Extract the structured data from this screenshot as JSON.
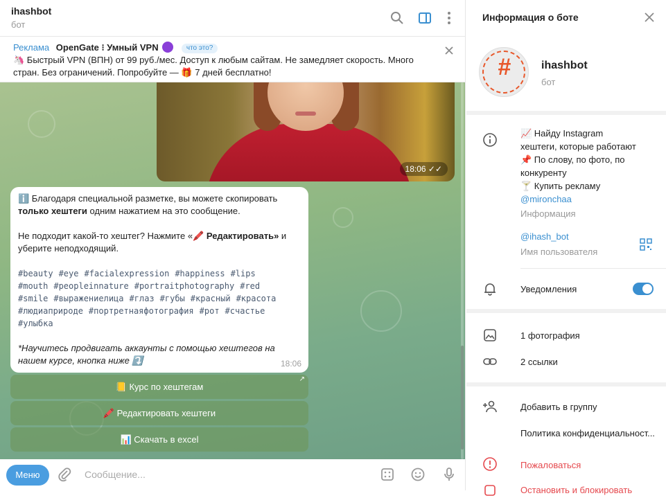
{
  "chat": {
    "title": "ihashbot",
    "subtitle": "бот"
  },
  "ad": {
    "label": "Реклама",
    "title": "OpenGate ⁝ Умный VPN",
    "what": "что это?",
    "text_line1": "🦄 Быстрый VPN (ВПН) от 99 руб./мес. Доступ к любым сайтам. Не замедляет скорость. Много",
    "text_line2": "стран. Без ограничений. Попробуйте — 🎁 7 дней бесплатно!"
  },
  "photo": {
    "time": "18:06"
  },
  "message": {
    "p1_pre": "ℹ️ Благодаря специальной разметке, вы можете скопировать",
    "p1_bold": "только хештеги",
    "p1_post": " одним нажатием на это сообщение.",
    "p2_pre": "Не подходит какой-то хештег? Нажмите «🖍️ ",
    "p2_bold": "Редактировать»",
    "p2_post": " и",
    "p2_line2": "уберите неподходящий.",
    "tags": [
      "#beauty",
      "#eye",
      "#facialexpression",
      "#happiness",
      "#lips",
      "#mouth",
      "#peopleinnature",
      "#portraitphotography",
      "#red",
      "#smile",
      "#выражениелица",
      "#глаз",
      "#губы",
      "#красный",
      "#красота",
      "#людиаприроде",
      "#портретнаяфотография",
      "#рот",
      "#счастье",
      "#улыбка"
    ],
    "footer_line1": "*Научитесь продвигать аккаунты с помощью хештегов на",
    "footer_line2": "нашем курсе, кнопка ниже ⤵️",
    "time": "18:06"
  },
  "keyboard": {
    "btn1": "📒 Курс по хештегам",
    "btn2": "🖍️ Редактировать хештеги",
    "btn3": "📊 Скачать в excel",
    "btn1_arrow": "↗"
  },
  "composer": {
    "menu": "Меню",
    "placeholder": "Сообщение..."
  },
  "info": {
    "title": "Информация о боте",
    "bot_name": "ihashbot",
    "bot_sub": "бот",
    "about_lines": [
      "📈 Найду Instagram",
      "хештеги, которые работают",
      "📌 По слову, по фото, по",
      "конкуренту",
      "🍸 Купить рекламу"
    ],
    "mention": "@mironchaa",
    "about_label": "Информация",
    "username": "@ihash_bot",
    "username_label": "Имя пользователя",
    "notifications": "Уведомления",
    "photos": "1 фотография",
    "links": "2 ссылки",
    "add_to_group": "Добавить в группу",
    "privacy": "Политика конфиденциальност...",
    "report": "Пожаловаться",
    "block_partial": "Остановить и блокировать"
  },
  "colors": {
    "accent": "#3a8fd0",
    "menu": "#4a9de0",
    "danger": "#e5484d"
  }
}
